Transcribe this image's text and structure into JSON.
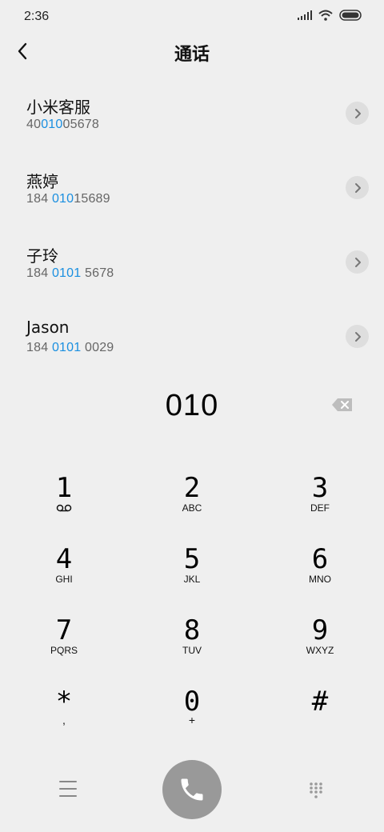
{
  "status": {
    "time": "2:36"
  },
  "header": {
    "title": "通话"
  },
  "results": [
    {
      "name": "小米客服",
      "number_pre": "40",
      "number_match": "010",
      "number_post": "05678"
    },
    {
      "name": "燕婷",
      "number_pre": "184 ",
      "number_match": "010",
      "number_post": "15689"
    },
    {
      "name": "子玲",
      "number_pre": "184 ",
      "number_match": "0101",
      "number_post": " 5678"
    },
    {
      "name": "Jason",
      "number_pre": "184 ",
      "number_match": "0101",
      "number_post": " 0029"
    }
  ],
  "dial": {
    "digits": "010"
  },
  "keypad": [
    [
      {
        "digit": "1",
        "sub": ""
      },
      {
        "digit": "2",
        "sub": "ABC"
      },
      {
        "digit": "3",
        "sub": "DEF"
      }
    ],
    [
      {
        "digit": "4",
        "sub": "GHI"
      },
      {
        "digit": "5",
        "sub": "JKL"
      },
      {
        "digit": "6",
        "sub": "MNO"
      }
    ],
    [
      {
        "digit": "7",
        "sub": "PQRS"
      },
      {
        "digit": "8",
        "sub": "TUV"
      },
      {
        "digit": "9",
        "sub": "WXYZ"
      }
    ],
    [
      {
        "digit": "*",
        "sub": ","
      },
      {
        "digit": "0",
        "sub": "+"
      },
      {
        "digit": "#",
        "sub": ""
      }
    ]
  ],
  "icons": {
    "back": "chevron-left-icon",
    "detail": "chevron-right-icon",
    "backspace": "backspace-icon",
    "voicemail": "voicemail-icon",
    "menu": "menu-icon",
    "call": "phone-icon",
    "dialpad": "dialpad-icon",
    "signal": "signal-icon",
    "wifi": "wifi-icon",
    "battery": "battery-icon"
  },
  "colors": {
    "background": "#efefef",
    "highlight": "#1a8fe0",
    "call_button": "#999999"
  }
}
